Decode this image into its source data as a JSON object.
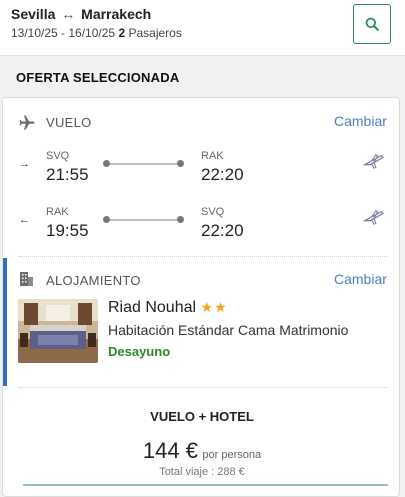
{
  "header": {
    "origin": "Sevilla",
    "destination": "Marrakech",
    "dates": "13/10/25 - 16/10/25",
    "passengers_count": "2",
    "passengers_label": "Pasajeros",
    "search_icon": "search-icon"
  },
  "section_title": "OFERTA SELECCIONADA",
  "flight": {
    "label": "VUELO",
    "change": "Cambiar",
    "outbound": {
      "direction_icon": "right-arrow",
      "from_code": "SVQ",
      "from_time": "21:55",
      "to_code": "RAK",
      "to_time": "22:20"
    },
    "inbound": {
      "direction_icon": "left-arrow",
      "from_code": "RAK",
      "from_time": "19:55",
      "to_code": "SVQ",
      "to_time": "22:20"
    }
  },
  "hotel": {
    "label": "ALOJAMIENTO",
    "change": "Cambiar",
    "name": "Riad Nouhal",
    "stars": "★★",
    "room": "Habitación Estándar Cama Matrimonio",
    "board": "Desayuno"
  },
  "summary": {
    "package": "VUELO + HOTEL",
    "price": "144 €",
    "per": "por persona",
    "total": "Total viaje : 288 €"
  },
  "colors": {
    "accent": "#3370b8",
    "brand_green": "#2e8b57",
    "board_green": "#2a8a2a",
    "link": "#4a7fc1",
    "star": "#f2a51f"
  }
}
